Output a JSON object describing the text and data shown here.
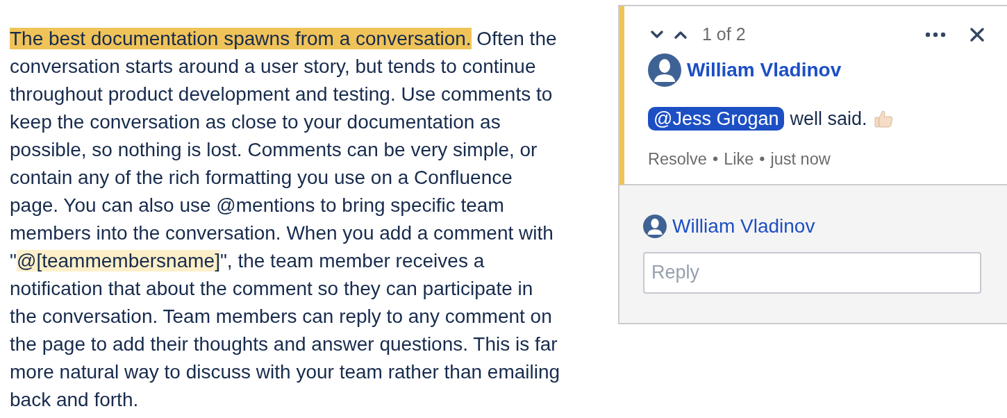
{
  "document": {
    "paragraph": [
      {
        "text": "The best documentation spawns from a conversation.",
        "kind": "comment_highlight"
      },
      {
        "text": " Often the conversation starts around a user story, but tends to continue throughout product development and testing. Use comments to keep the conversation as close to your documentation as possible, so nothing is lost. Comments can be very simple, or contain any of the rich formatting you use on a Confluence page. You can also use @mentions to bring specific team members into the conversation. When you add a comment with \"",
        "kind": "plain"
      },
      {
        "text": "@[teammembersname]",
        "kind": "inline_highlight"
      },
      {
        "text": "\", the team member receives a notification that about the comment so they can participate in the conversation. Team members can reply to any comment on the page to add their thoughts and answer questions. This is far more natural way to discuss with your team rather than emailing back and forth.",
        "kind": "plain"
      }
    ]
  },
  "comment_panel": {
    "counter": "1 of 2",
    "comment": {
      "author": "William Vladinov",
      "mention": "@Jess Grogan",
      "text": "well said.",
      "separator": "•",
      "footer": [
        "Resolve",
        "Like",
        "just now"
      ]
    },
    "reply": {
      "author": "William Vladinov",
      "placeholder": "Reply"
    }
  }
}
